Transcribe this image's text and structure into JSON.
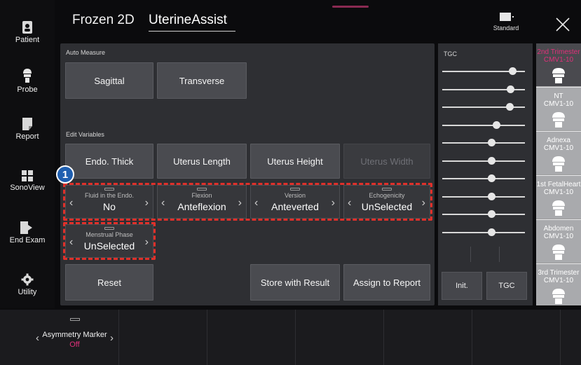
{
  "nav": {
    "items": [
      {
        "label": "Patient",
        "icon": "patient-icon"
      },
      {
        "label": "Probe",
        "icon": "probe-icon"
      },
      {
        "label": "Report",
        "icon": "report-icon"
      },
      {
        "label": "SonoView",
        "icon": "sonoview-icon"
      },
      {
        "label": "End Exam",
        "icon": "end-exam-icon"
      },
      {
        "label": "Utility",
        "icon": "gear-icon"
      }
    ]
  },
  "header": {
    "mode": "Frozen 2D",
    "app": "UterineAssist",
    "display_mode": "Standard"
  },
  "auto_measure": {
    "label": "Auto Measure",
    "buttons": [
      "Sagittal",
      "Transverse"
    ]
  },
  "edit_variables": {
    "label": "Edit Variables",
    "buttons": [
      "Endo. Thick",
      "Uterus Length",
      "Uterus Height",
      "Uterus Width"
    ],
    "params": [
      {
        "label": "Fluid in the Endo.",
        "value": "No"
      },
      {
        "label": "Flexion",
        "value": "Anteflexion"
      },
      {
        "label": "Version",
        "value": "Anteverted"
      },
      {
        "label": "Echogenicity",
        "value": "UnSelected"
      },
      {
        "label": "Menstrual Phase",
        "value": "UnSelected"
      }
    ],
    "marker": "1"
  },
  "actions": {
    "reset": "Reset",
    "store": "Store with Result",
    "assign": "Assign to Report"
  },
  "tgc": {
    "label": "TGC",
    "slider_levels": [
      0.85,
      0.82,
      0.81,
      0.65,
      0.59,
      0.59,
      0.59,
      0.59,
      0.59,
      0.59
    ],
    "init": "Init.",
    "tgc_button": "TGC"
  },
  "probes": [
    {
      "name": "2nd Trimester",
      "probe": "CMV1-10",
      "selected": true
    },
    {
      "name": "NT",
      "probe": "CMV1-10",
      "selected": false
    },
    {
      "name": "Adnexa",
      "probe": "CMV1-10",
      "selected": false
    },
    {
      "name": "1st FetalHeart",
      "probe": "CMV1-10",
      "selected": false
    },
    {
      "name": "Abdomen",
      "probe": "CMV1-10",
      "selected": false
    },
    {
      "name": "3rd Trimester",
      "probe": "CMV1-10",
      "selected": false
    }
  ],
  "bottom": {
    "asymmetry_label": "Asymmetry Marker",
    "asymmetry_value": "Off"
  },
  "colors": {
    "accent": "#e0307a",
    "highlight_dash": "#e0302a",
    "marker": "#1f5fb0"
  }
}
